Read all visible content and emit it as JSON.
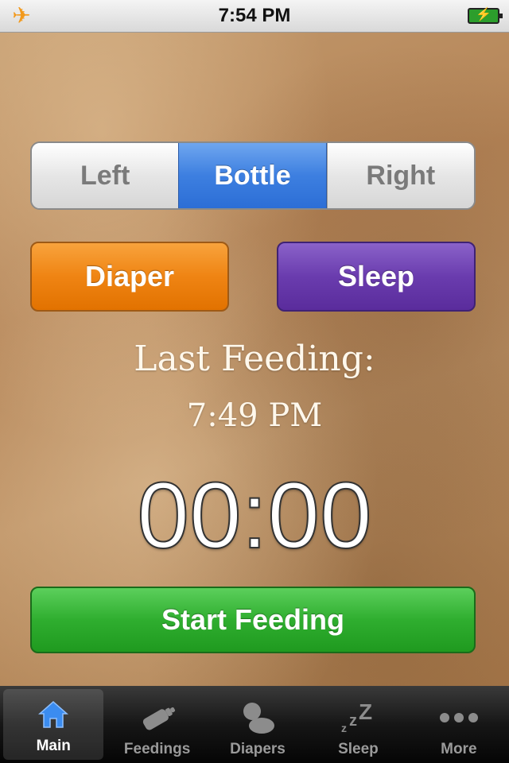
{
  "status_bar": {
    "time": "7:54 PM",
    "icons": [
      "airplane-icon",
      "battery-icon"
    ]
  },
  "segmented_control": {
    "options": [
      "Left",
      "Bottle",
      "Right"
    ],
    "selected": "Bottle"
  },
  "buttons": {
    "diaper": "Diaper",
    "sleep": "Sleep",
    "start_feeding": "Start Feeding"
  },
  "feeding": {
    "last_label": "Last Feeding:",
    "last_time": "7:49 PM",
    "timer": "00:00"
  },
  "tab_bar": {
    "items": [
      {
        "label": "Main",
        "icon": "home-icon",
        "active": true
      },
      {
        "label": "Feedings",
        "icon": "bottle-icon",
        "active": false
      },
      {
        "label": "Diapers",
        "icon": "baby-icon",
        "active": false
      },
      {
        "label": "Sleep",
        "icon": "zzz-icon",
        "active": false
      },
      {
        "label": "More",
        "icon": "more-dots-icon",
        "active": false
      }
    ]
  },
  "colors": {
    "selected_segment": "#3d7fe0",
    "diaper": "#ef8413",
    "sleep": "#6a3cae",
    "start_feeding": "#2fae2f",
    "active_tab_icon": "#3b8cf0"
  }
}
